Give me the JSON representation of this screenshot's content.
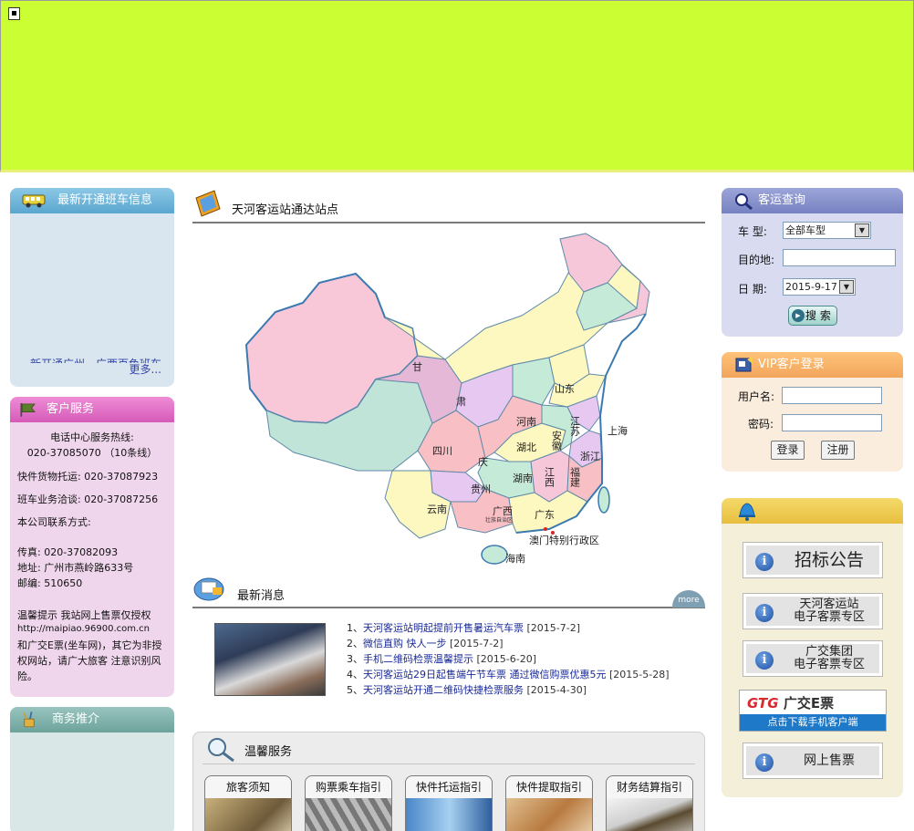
{
  "left": {
    "routes": {
      "title": "最新开通班车信息",
      "marquee": "新开通广州—广西百色班车",
      "more": "更多..."
    },
    "service": {
      "title": "客户服务",
      "hotline_label": "电话中心服务热线:",
      "hotline": "020-37085070 （10条线）",
      "cargo": "快件货物托运: 020-37087923",
      "business": "班车业务洽谈: 020-37087256",
      "contact_label": "本公司联系方式:",
      "fax": "传真: 020-37082093",
      "address": "地址: 广州市燕岭路633号",
      "postcode": "邮编: 510650",
      "tip_1": "温馨提示 我站网上售票仅授权",
      "tip_url": "http://maipiao.96900.com.cn",
      "tip_2": "和广交E票(坐车网)，其它为非授权网站，请广大旅客 注意识别风险。"
    },
    "biz": {
      "title": "商务推介"
    }
  },
  "center": {
    "stations_title": "天河客运站通达站点",
    "map": {
      "provinces": [
        "甘",
        "肃",
        "山东",
        "江苏",
        "上海",
        "河南",
        "安徽",
        "四川",
        "庆",
        "湖北",
        "浙江",
        "湖南",
        "江西",
        "福建",
        "贵州",
        "云南",
        "广西",
        "广东",
        "澳门特别行政区",
        "海南"
      ],
      "guangxi_sub": "壮族自治区"
    },
    "news": {
      "title": "最新消息",
      "more": "more",
      "items": [
        {
          "num": "1、",
          "text": "天河客运站明起提前开售暑运汽车票",
          "date": "[2015-7-2]"
        },
        {
          "num": "2、",
          "text": "微信直购  快人一步",
          "date": "[2015-7-2]"
        },
        {
          "num": "3、",
          "text": "手机二维码检票温馨提示",
          "date": "[2015-6-20]"
        },
        {
          "num": "4、",
          "text": "天河客运站29日起售端午节车票 通过微信购票优惠5元",
          "date": "[2015-5-28]"
        },
        {
          "num": "5、",
          "text": "天河客运站开通二维码快捷检票服务",
          "date": "[2015-4-30]"
        }
      ]
    },
    "warm": {
      "title": "温馨服务",
      "tabs": [
        "旅客须知",
        "购票乘车指引",
        "快件托运指引",
        "快件提取指引",
        "财务结算指引"
      ]
    }
  },
  "right": {
    "query": {
      "title": "客运查询",
      "type_label": "车  型:",
      "type_value": "全部车型",
      "dest_label": "目的地:",
      "dest_value": "",
      "date_label": "日  期:",
      "date_value": "2015-9-17",
      "search_btn": "搜 索"
    },
    "vip": {
      "title": "VIP客户登录",
      "user_label": "用户名:",
      "pass_label": "密码:",
      "login_btn": "登录",
      "register_btn": "注册"
    },
    "notice": {
      "btn1": "招标公告",
      "btn2_l1": "天河客运站",
      "btn2_l2": "电子客票专区",
      "btn3_l1": "广交集团",
      "btn3_l2": "电子客票专区",
      "gtg_logo": "GTG",
      "gtg_name": "广交E票",
      "gtg_sub": "点击下载手机客户端",
      "btn4": "网上售票"
    }
  },
  "colors": {
    "banner": "#ccff33",
    "link": "#1a2a99"
  }
}
